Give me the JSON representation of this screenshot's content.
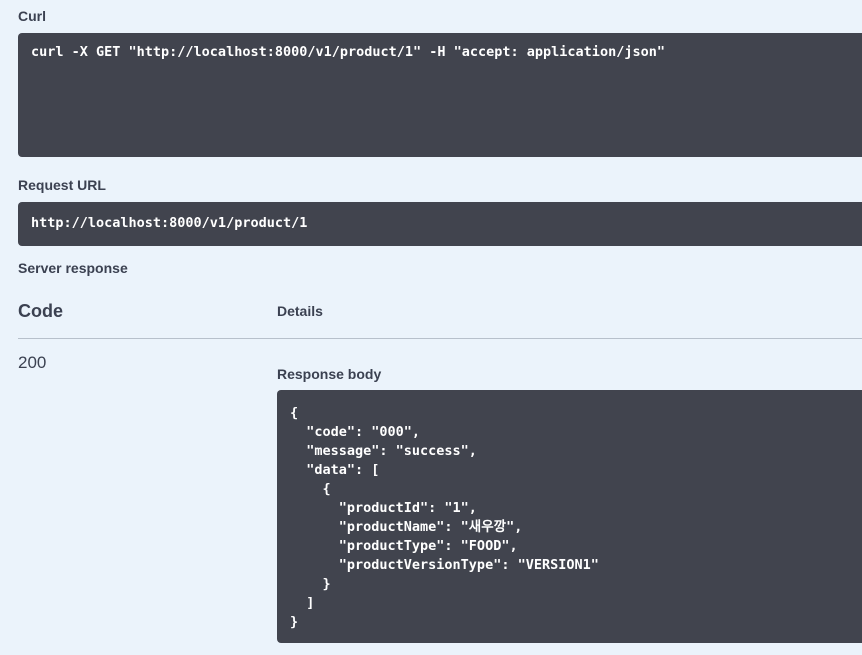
{
  "curl": {
    "label": "Curl",
    "command": "curl -X GET \"http://localhost:8000/v1/product/1\" -H \"accept: application/json\""
  },
  "request_url": {
    "label": "Request URL",
    "value": "http://localhost:8000/v1/product/1"
  },
  "server_response": {
    "label": "Server response",
    "columns": {
      "code": "Code",
      "details": "Details"
    },
    "code": "200",
    "response_body_label": "Response body",
    "response_body": "{\n  \"code\": \"000\",\n  \"message\": \"success\",\n  \"data\": [\n    {\n      \"productId\": \"1\",\n      \"productName\": \"새우깡\",\n      \"productType\": \"FOOD\",\n      \"productVersionType\": \"VERSION1\"\n    }\n  ]\n}"
  }
}
